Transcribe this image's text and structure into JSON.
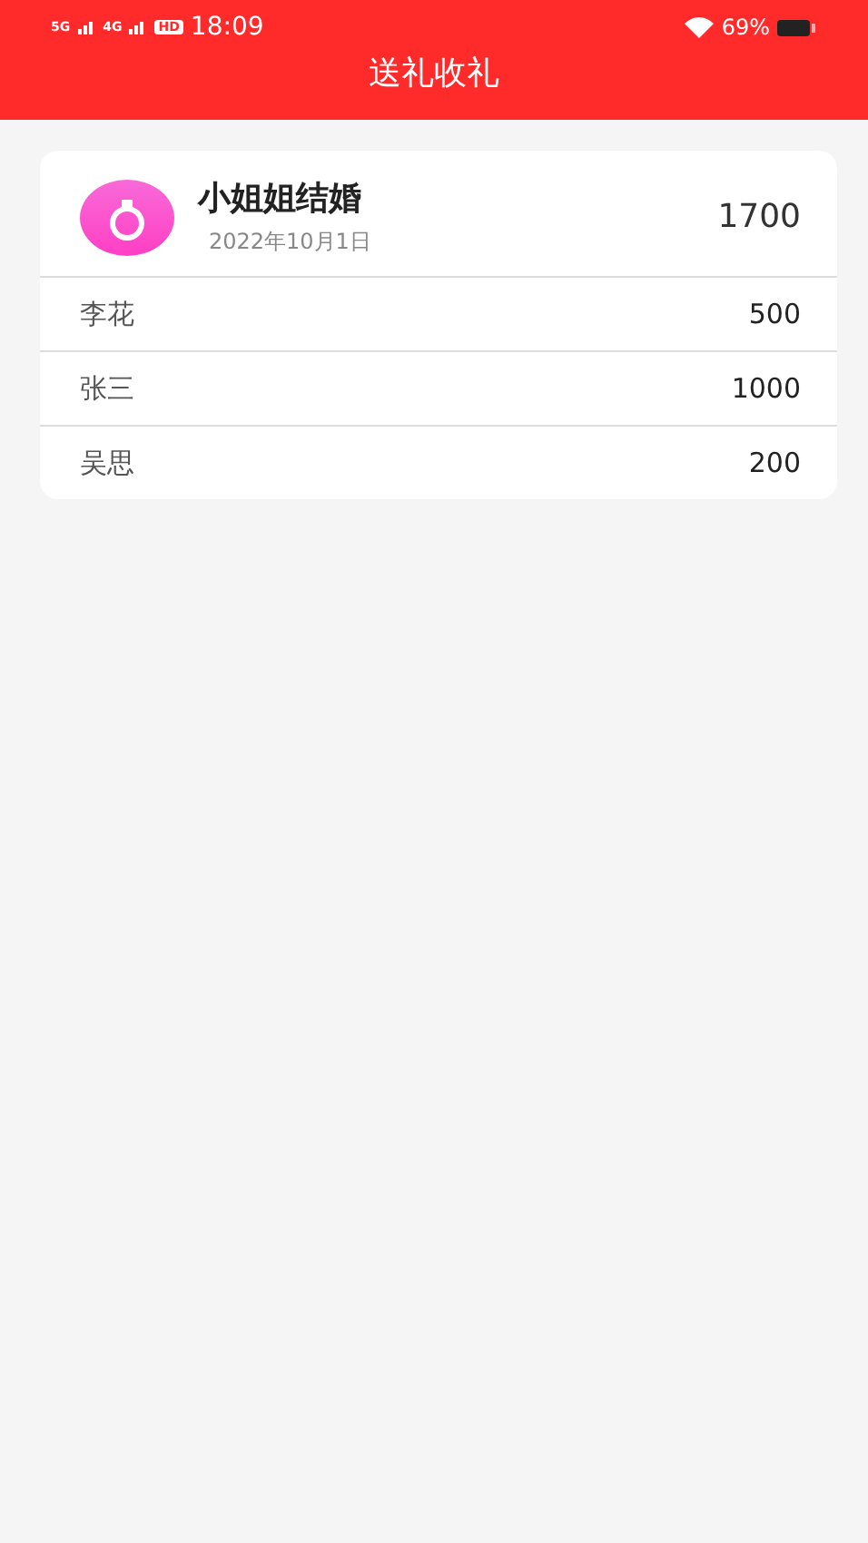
{
  "status_bar": {
    "network_1": "5G",
    "network_2": "4G",
    "hd": "HD",
    "time": "18:09",
    "battery": "69%"
  },
  "title": "送礼收礼",
  "event": {
    "name": "小姐姐结婚",
    "date": "2022年10月1日",
    "total": "1700",
    "gifts": [
      {
        "name": "李花",
        "amount": "500"
      },
      {
        "name": "张三",
        "amount": "1000"
      },
      {
        "name": "吴思",
        "amount": "200"
      }
    ]
  }
}
